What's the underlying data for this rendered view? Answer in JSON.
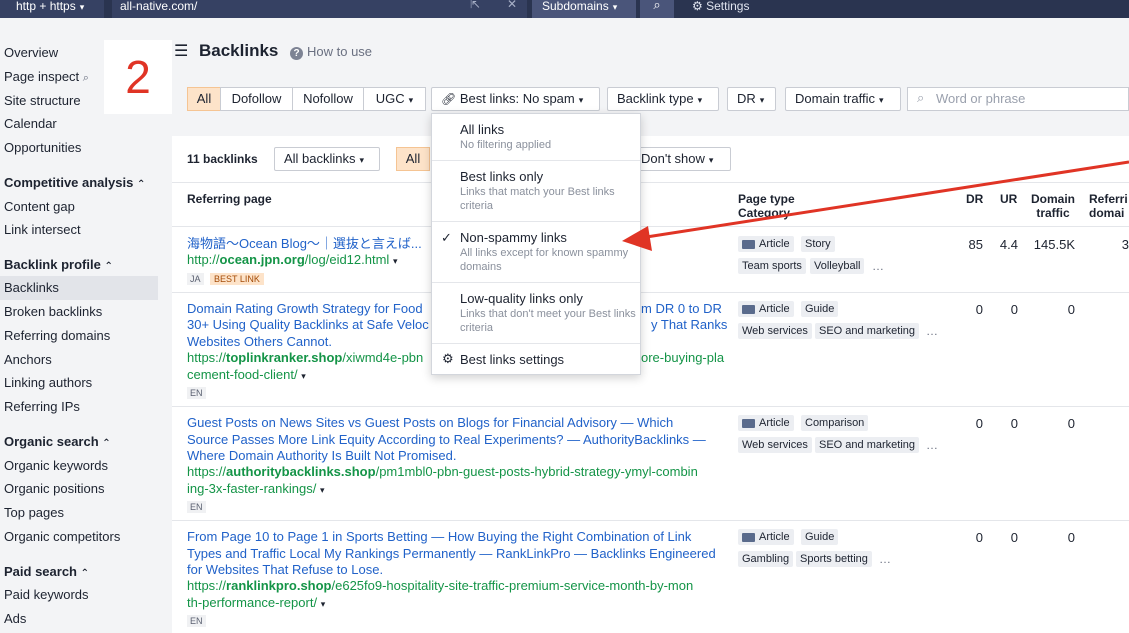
{
  "topbar": {
    "protocol": "http + https",
    "url": "all-native.com/",
    "mode": "Subdomains",
    "settings": "Settings"
  },
  "step_number": "2",
  "sidebar": {
    "items_top": [
      "Overview",
      "Page inspect",
      "Site structure",
      "Calendar",
      "Opportunities"
    ],
    "competitive_analysis": {
      "title": "Competitive analysis",
      "items": [
        "Content gap",
        "Link intersect"
      ]
    },
    "backlink_profile": {
      "title": "Backlink profile",
      "items": [
        "Backlinks",
        "Broken backlinks",
        "Referring domains",
        "Anchors",
        "Linking authors",
        "Referring IPs"
      ]
    },
    "organic_search": {
      "title": "Organic search",
      "items": [
        "Organic keywords",
        "Organic positions",
        "Top pages",
        "Organic competitors"
      ]
    },
    "paid_search": {
      "title": "Paid search",
      "items": [
        "Paid keywords",
        "Ads"
      ]
    },
    "active": "Backlinks"
  },
  "header": {
    "title": "Backlinks",
    "how_to": "How to use"
  },
  "filters": {
    "segments": [
      "All",
      "Dofollow",
      "Nofollow",
      "UGC"
    ],
    "active_segment": "All",
    "best_links": "Best links: No spam",
    "backlink_type": "Backlink type",
    "dr": "DR",
    "domain_traffic": "Domain traffic",
    "search_placeholder": "Word or phrase"
  },
  "subbar": {
    "count": "11 backlinks",
    "all_backlinks": "All backlinks",
    "all": "All",
    "dont_show": "Don't show"
  },
  "columns": {
    "referring_page": "Referring page",
    "page_type": "Page type",
    "category": "Category",
    "dr": "DR",
    "ur": "UR",
    "domain": "Domain",
    "traffic": "traffic",
    "referring": "Referri",
    "domains": "domai"
  },
  "menu": {
    "items": [
      {
        "title": "All links",
        "desc": "No filtering applied"
      },
      {
        "title": "Best links only",
        "desc": "Links that match your Best links criteria"
      },
      {
        "title": "Non-spammy links",
        "desc": "All links except for known spammy domains"
      },
      {
        "title": "Low-quality links only",
        "desc": "Links that don't meet your Best links criteria"
      }
    ],
    "checked": "Non-spammy links",
    "settings": "Best links settings"
  },
  "rows": [
    {
      "title": "海物語～Ocean Blog～｜選抜と言えば...",
      "title_tail": "",
      "url_prefix": "http://",
      "url_domain": "ocean.jpn.org",
      "url_path": "/log/eid12.html",
      "lang": "JA",
      "best_link": "BEST LINK",
      "tags_row1": [
        "Article",
        "Story"
      ],
      "tags_row2": [
        "Team sports",
        "Volleyball"
      ],
      "dr": "85",
      "ur": "4.4",
      "traffic": "145.5K",
      "refdomains": "3"
    },
    {
      "title": "Domain Rating Growth Strategy for Food",
      "title_tail": "m DR 0 to DR",
      "title_line2_left": "30+ Using Quality Backlinks at Safe Veloc",
      "title_line2_right": "y That Ranks",
      "title_line3": "Websites Others Cannot.",
      "url_prefix": "https://",
      "url_domain": "toplinkranker.shop",
      "url_path_left": "/xiwmd4e-pbn",
      "url_path_right": "ore-buying-pla",
      "url_line2": "cement-food-client/",
      "lang": "EN",
      "tags_row1": [
        "Article",
        "Guide"
      ],
      "tags_row2": [
        "Web services",
        "SEO and marketing"
      ],
      "dr": "0",
      "ur": "0",
      "traffic": "0"
    },
    {
      "title_l1": "Guest Posts on News Sites vs Guest Posts on Blogs for Financial Advisory — Which",
      "title_l2": "Source Passes More Link Equity According to Real Experiments? — AuthorityBacklinks —",
      "title_l3": "Where Domain Authority Is Built Not Promised.",
      "url_prefix": "https://",
      "url_domain": "authoritybacklinks.shop",
      "url_path": "/pm1mbl0-pbn-guest-posts-hybrid-strategy-ymyl-combin",
      "url_line2": "ing-3x-faster-rankings/",
      "lang": "EN",
      "tags_row1": [
        "Article",
        "Comparison"
      ],
      "tags_row2": [
        "Web services",
        "SEO and marketing"
      ],
      "dr": "0",
      "ur": "0",
      "traffic": "0"
    },
    {
      "title_l1": "From Page 10 to Page 1 in Sports Betting — How Buying the Right Combination of Link",
      "title_l2": "Types and Traffic Local My Rankings Permanently — RankLinkPro — Backlinks Engineered",
      "title_l3": "for Websites That Refuse to Lose.",
      "url_prefix": "https://",
      "url_domain": "ranklinkpro.shop",
      "url_path": "/e625fo9-hospitality-site-traffic-premium-service-month-by-mon",
      "url_line2": "th-performance-report/",
      "lang": "EN",
      "tags_row1": [
        "Article",
        "Guide"
      ],
      "tags_row2": [
        "Gambling",
        "Sports betting"
      ],
      "dr": "0",
      "ur": "0",
      "traffic": "0"
    }
  ],
  "colors": {
    "topbar": "#2a3450",
    "accent_orange": "#fde3c9",
    "link_blue": "#2162c9",
    "url_green": "#149447",
    "annotation_red": "#e03425"
  }
}
